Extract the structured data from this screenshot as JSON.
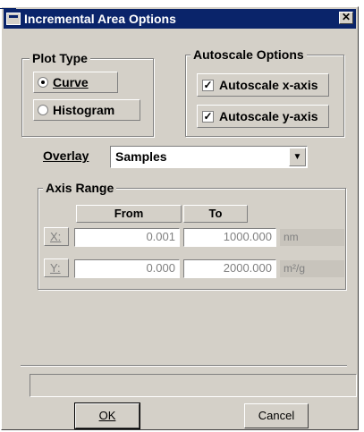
{
  "window": {
    "title": "Incremental Area Options",
    "close_glyph": "✕"
  },
  "plot_type": {
    "title": "Plot Type",
    "options": [
      {
        "label": "Curve",
        "selected": true
      },
      {
        "label": "Histogram",
        "selected": false
      }
    ]
  },
  "autoscale": {
    "title": "Autoscale Options",
    "options": [
      {
        "label": "Autoscale x-axis",
        "checked": true
      },
      {
        "label": "Autoscale y-axis",
        "checked": true
      }
    ]
  },
  "overlay": {
    "label": "Overlay",
    "value": "Samples",
    "arrow": "▼"
  },
  "axis_range": {
    "title": "Axis Range",
    "from_header": "From",
    "to_header": "To",
    "x": {
      "label": "X:",
      "from": "0.001",
      "to": "1000.000",
      "unit": "nm"
    },
    "y": {
      "label": "Y:",
      "from": "0.000",
      "to": "2000.000",
      "unit": "m²/g"
    }
  },
  "status_bar": {
    "text": ""
  },
  "buttons": {
    "ok": "OK",
    "cancel": "Cancel"
  }
}
